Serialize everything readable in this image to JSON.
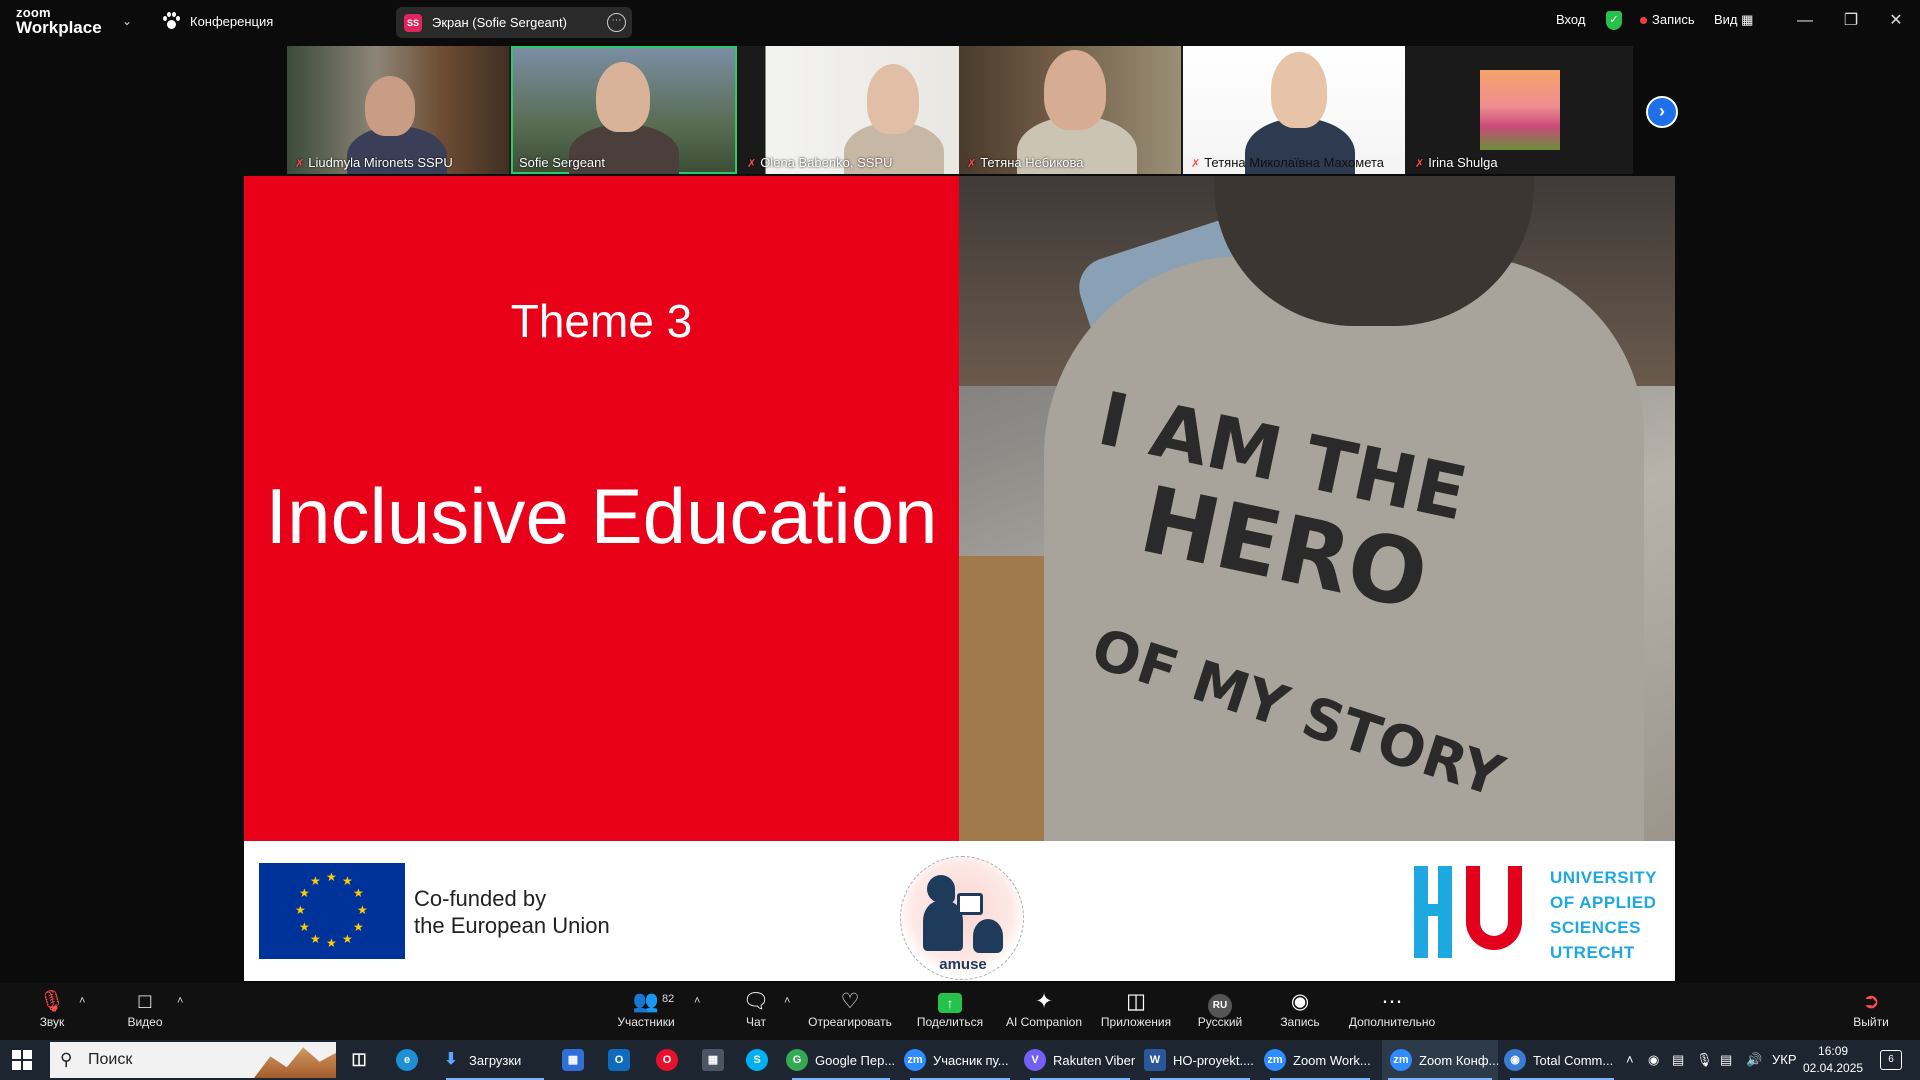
{
  "app": {
    "brand_top": "zoom",
    "brand_bottom": "Workplace",
    "conference_label": "Конференция"
  },
  "share": {
    "badge": "SS",
    "label": "Экран (Sofie Sergeant)"
  },
  "titlebar": {
    "login": "Вход",
    "record": "Запись",
    "view": "Вид"
  },
  "participants_strip": [
    {
      "name": "Liudmyla Mironets SSPU",
      "muted": true,
      "active": false
    },
    {
      "name": "Sofie Sergeant",
      "muted": false,
      "active": true
    },
    {
      "name": "Olena Babenko, SSPU",
      "muted": true,
      "active": false
    },
    {
      "name": "Тетяна Небикова",
      "muted": true,
      "active": false
    },
    {
      "name": "Тетяна Миколаївна Махомета",
      "muted": true,
      "active": false
    },
    {
      "name": "Irina Shulga",
      "muted": true,
      "active": false
    }
  ],
  "slide": {
    "theme": "Theme 3",
    "title": "Inclusive Education",
    "shirt_lines": [
      "I AM THE",
      "HERO",
      "OF MY STORY"
    ],
    "eu_text_1": "Co-funded by",
    "eu_text_2": "the European Union",
    "amuse": "amuse",
    "uni_lines": [
      "UNIVERSITY",
      "OF APPLIED",
      "SCIENCES",
      "UTRECHT"
    ]
  },
  "toolbar": {
    "audio": "Звук",
    "video": "Видео",
    "participants": "Участники",
    "participants_count": "82",
    "chat": "Чат",
    "react": "Отреагировать",
    "share": "Поделиться",
    "ai": "AI Companion",
    "apps": "Приложения",
    "language_badge": "RU",
    "language": "Русский",
    "record": "Запись",
    "more": "Дополнительно",
    "leave": "Выйти"
  },
  "taskbar": {
    "search_placeholder": "Поиск",
    "apps": [
      {
        "label": "Загрузки"
      },
      {
        "label": "Google Пер..."
      },
      {
        "label": "Учасник пу..."
      },
      {
        "label": "Rakuten Viber"
      },
      {
        "label": "HO-proyekt...."
      },
      {
        "label": "Zoom Work..."
      },
      {
        "label": "Zoom Конф..."
      },
      {
        "label": "Total Comm..."
      }
    ],
    "lang": "УКР",
    "time": "16:09",
    "date": "02.04.2025",
    "notifications": "6"
  },
  "colors": {
    "slide_red": "#e90019",
    "active_border": "#2cc86a",
    "share_green": "#27c24c",
    "eu_blue": "#003399",
    "hu_blue": "#1da8e0",
    "accent_blue": "#1f6feb"
  }
}
